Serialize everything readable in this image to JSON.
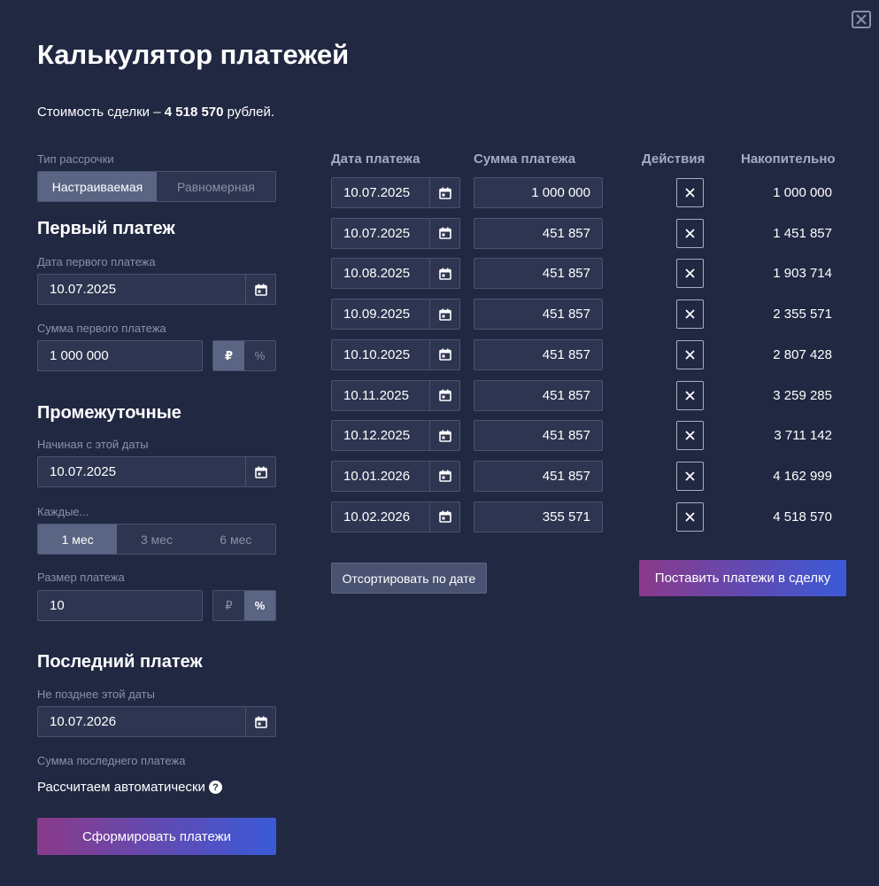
{
  "title": "Калькулятор платежей",
  "deal_cost": {
    "prefix": "Стоимость сделки –",
    "amount": "4 518 570",
    "suffix": "рублей."
  },
  "installment_type": {
    "label": "Тип рассрочки",
    "options": [
      "Настраиваемая",
      "Равномерная"
    ],
    "selected": "Настраиваемая"
  },
  "first_payment": {
    "heading": "Первый платеж",
    "date_label": "Дата первого платежа",
    "date_value": "10.07.2025",
    "amount_label": "Сумма первого платежа",
    "amount_value": "1 000 000",
    "unit_rub": "₽",
    "unit_pct": "%",
    "selected_unit": "₽"
  },
  "intermediate": {
    "heading": "Промежуточные",
    "start_label": "Начиная с этой даты",
    "start_value": "10.07.2025",
    "every_label": "Каждые...",
    "every_options": [
      "1 мес",
      "3 мес",
      "6 мес"
    ],
    "every_selected": "1 мес",
    "size_label": "Размер платежа",
    "size_value": "10",
    "unit_rub": "₽",
    "unit_pct": "%",
    "selected_unit": "%"
  },
  "last_payment": {
    "heading": "Последний платеж",
    "date_label": "Не позднее этой даты",
    "date_value": "10.07.2026",
    "amount_label": "Сумма последнего платежа",
    "amount_auto": "Рассчитаем автоматически",
    "help": "?"
  },
  "generate_button": "Сформировать платежи",
  "schedule": {
    "columns": {
      "date": "Дата платежа",
      "amount": "Сумма платежа",
      "actions": "Действия",
      "cumulative": "Накопительно"
    },
    "rows": [
      {
        "date": "10.07.2025",
        "amount": "1 000 000",
        "cumulative": "1 000 000"
      },
      {
        "date": "10.07.2025",
        "amount": "451 857",
        "cumulative": "1 451 857"
      },
      {
        "date": "10.08.2025",
        "amount": "451 857",
        "cumulative": "1 903 714"
      },
      {
        "date": "10.09.2025",
        "amount": "451 857",
        "cumulative": "2 355 571"
      },
      {
        "date": "10.10.2025",
        "amount": "451 857",
        "cumulative": "2 807 428"
      },
      {
        "date": "10.11.2025",
        "amount": "451 857",
        "cumulative": "3 259 285"
      },
      {
        "date": "10.12.2025",
        "amount": "451 857",
        "cumulative": "3 711 142"
      },
      {
        "date": "10.01.2026",
        "amount": "451 857",
        "cumulative": "4 162 999"
      },
      {
        "date": "10.02.2026",
        "amount": "355 571",
        "cumulative": "4 518 570"
      }
    ]
  },
  "sort_button": "Отсортировать по дате",
  "apply_button": "Поставить платежи в сделку",
  "icons": {
    "close": "close-icon",
    "calendar": "calendar-icon",
    "delete": "x-icon",
    "help": "question-circle-icon"
  },
  "colors": {
    "background": "#212842",
    "input_bg": "#2d3550",
    "border": "#4a5272",
    "active": "#5a6584",
    "gradient_start": "#8a3a8a",
    "gradient_end": "#3a5ad8"
  }
}
